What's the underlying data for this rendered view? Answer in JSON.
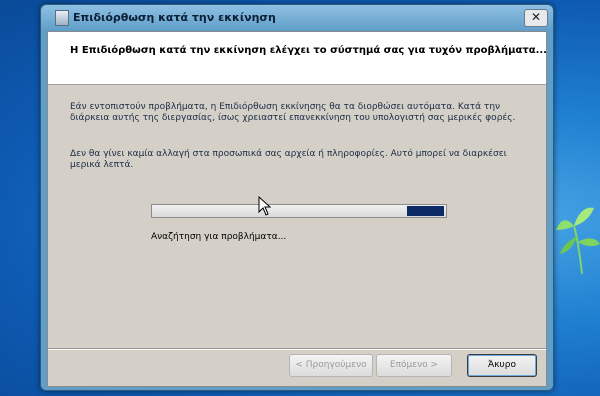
{
  "window": {
    "title": "Επιδιόρθωση κατά την εκκίνηση",
    "close_glyph": "✕"
  },
  "header": {
    "text": "Η Επιδιόρθωση κατά την εκκίνηση ελέγχει το σύστημά σας για τυχόν προβλήματα..."
  },
  "description": {
    "paragraph1": "Εάν εντοπιστούν προβλήματα, η Επιδιόρθωση εκκίνησης θα τα διορθώσει αυτόματα. Κατά την διάρκεια αυτής της διεργασίας, ίσως χρειαστεί επανεκκίνηση του υπολογιστή σας μερικές φορές.",
    "paragraph2": "Δεν θα γίνει καμία αλλαγή στα προσωπικά σας αρχεία ή πληροφορίες. Αυτό μπορεί να διαρκέσει μερικά λεπτά."
  },
  "progress": {
    "type": "marquee",
    "status": "Αναζήτηση για προβλήματα..."
  },
  "buttons": {
    "back": "< Προηγούμενο",
    "next": "Επόμενο >",
    "cancel": "Άκυρο"
  },
  "colors": {
    "progress_chunk": "#0b2a66",
    "desc_text": "#1b2c44"
  },
  "icons": [
    "startup-repair-icon",
    "close-icon",
    "mouse-cursor-icon",
    "windows-leaf-icon"
  ]
}
